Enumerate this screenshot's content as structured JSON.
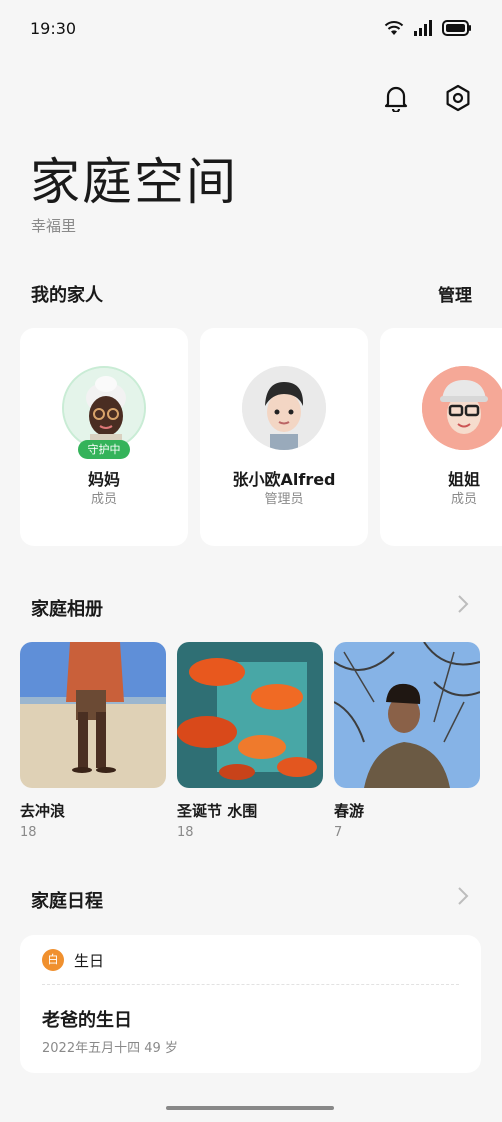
{
  "status": {
    "time": "19:30"
  },
  "header": {
    "title": "家庭空间",
    "subtitle": "幸福里",
    "bell_icon": "bell-icon",
    "settings_icon": "gear-icon"
  },
  "family": {
    "title": "我的家人",
    "manage_label": "管理",
    "members": [
      {
        "name": "妈妈",
        "role": "成员",
        "badge": "守护中"
      },
      {
        "name": "张小欧Alfred",
        "role": "管理员"
      },
      {
        "name": "姐姐",
        "role": "成员"
      }
    ]
  },
  "album": {
    "title": "家庭相册",
    "items": [
      {
        "name": "去冲浪",
        "count": "18"
      },
      {
        "name": "圣诞节 水围",
        "count": "18"
      },
      {
        "name": "春游",
        "count": "7"
      }
    ]
  },
  "schedule": {
    "title": "家庭日程",
    "type_icon_char": "白",
    "type_label": "生日",
    "event_title": "老爸的生日",
    "event_date": "2022年五月十四 49 岁"
  },
  "colors": {
    "accent_green": "#34b35a",
    "birthday_orange": "#f0902e"
  }
}
